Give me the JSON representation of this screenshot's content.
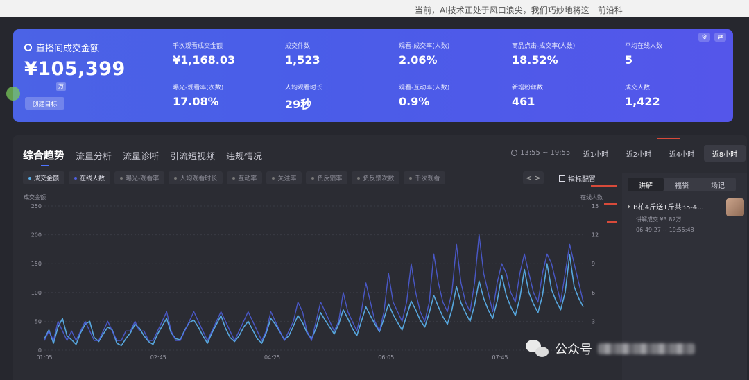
{
  "caption": "当前，AI技术正处于风口浪尖，我们巧妙地将这一前沿科",
  "hero": {
    "title": "直播间成交金额",
    "value": "¥105,399",
    "unit": "万",
    "goal_button": "创建目标"
  },
  "metrics": [
    {
      "label": "千次观看成交金额",
      "value": "¥1,168.03"
    },
    {
      "label": "成交件数",
      "value": "1,523"
    },
    {
      "label": "观看-成交率(人数)",
      "value": "2.06%"
    },
    {
      "label": "商品点击-成交率(人数)",
      "value": "18.52%"
    },
    {
      "label": "平均在线人数",
      "value": "5"
    },
    {
      "label": "曝光-观看率(次数)",
      "value": "17.08%"
    },
    {
      "label": "人均观看时长",
      "value": "29秒"
    },
    {
      "label": "观看-互动率(人数)",
      "value": "0.9%"
    },
    {
      "label": "新增粉丝数",
      "value": "461"
    },
    {
      "label": "成交人数",
      "value": "1,422"
    }
  ],
  "tabs": [
    "综合趋势",
    "流量分析",
    "流量诊断",
    "引流短视频",
    "违规情况"
  ],
  "time_range": "13:55 ~ 19:55",
  "periods": [
    "近1小时",
    "近2小时",
    "近4小时",
    "近8小时"
  ],
  "active_period": "近8小时",
  "chips": [
    "成交金额",
    "在线人数",
    "曝光-观看率",
    "人均观看时长",
    "互动率",
    "关注率",
    "负反馈率",
    "负反馈次数",
    "千次观看"
  ],
  "chip_nav": "< >",
  "config_label": "指标配置",
  "side_tabs": [
    "讲解",
    "福袋",
    "场记"
  ],
  "record": {
    "title": "B柏4斤送1斤共35-4...",
    "sub": "讲解成交 ¥3.82万",
    "time": "06:49:27 ~ 19:55:48"
  },
  "watermark": "公众号",
  "colors": {
    "card": "#4b63e6",
    "series_a": "#5aaee8",
    "series_b": "#4f5fe0",
    "accent": "#4f73ff"
  },
  "chart_data": {
    "type": "line",
    "left_axis_label": "成交金额",
    "right_axis_label": "在线人数",
    "left_ticks": [
      "250",
      "200",
      "150",
      "100",
      "50",
      "0"
    ],
    "right_ticks": [
      "15",
      "12",
      "9",
      "6",
      "3"
    ],
    "x_ticks": [
      "01:05",
      "02:45",
      "04:25",
      "06:05",
      "07:45"
    ],
    "ylim_left": [
      0,
      250
    ],
    "ylim_right": [
      0,
      15
    ],
    "series": [
      {
        "name": "成交金额",
        "axis": "left",
        "values": [
          20,
          35,
          12,
          40,
          55,
          25,
          18,
          10,
          30,
          45,
          50,
          22,
          15,
          28,
          40,
          35,
          12,
          8,
          20,
          30,
          45,
          38,
          25,
          15,
          10,
          28,
          42,
          55,
          30,
          20,
          18,
          35,
          48,
          52,
          40,
          25,
          12,
          30,
          45,
          60,
          38,
          22,
          15,
          25,
          40,
          50,
          35,
          20,
          12,
          30,
          55,
          45,
          32,
          18,
          25,
          42,
          60,
          48,
          30,
          20,
          38,
          65,
          52,
          40,
          28,
          45,
          70,
          55,
          38,
          25,
          50,
          75,
          60,
          45,
          32,
          55,
          80,
          62,
          48,
          35,
          60,
          85,
          70,
          52,
          40,
          65,
          95,
          75,
          58,
          45,
          70,
          110,
          82,
          65,
          50,
          78,
          120,
          90,
          70,
          55,
          85,
          130,
          95,
          75,
          60,
          90,
          140,
          100,
          80,
          65,
          95,
          150,
          105,
          85,
          70,
          100,
          165,
          110,
          90,
          75
        ]
      },
      {
        "name": "在线人数",
        "axis": "right",
        "values": [
          1,
          2,
          1,
          3,
          2,
          1,
          2,
          1,
          2,
          3,
          2,
          1,
          1,
          2,
          3,
          2,
          1,
          1,
          2,
          2,
          3,
          2,
          2,
          1,
          1,
          2,
          3,
          4,
          2,
          1,
          1,
          2,
          3,
          4,
          3,
          2,
          1,
          2,
          3,
          4,
          3,
          2,
          1,
          2,
          3,
          4,
          3,
          2,
          1,
          2,
          4,
          3,
          2,
          1,
          2,
          3,
          5,
          4,
          2,
          1,
          3,
          5,
          4,
          3,
          2,
          3,
          6,
          4,
          3,
          2,
          4,
          7,
          5,
          3,
          2,
          4,
          8,
          5,
          4,
          3,
          5,
          9,
          6,
          4,
          3,
          5,
          10,
          7,
          5,
          4,
          6,
          11,
          7,
          5,
          4,
          7,
          12,
          8,
          6,
          4,
          7,
          9,
          8,
          6,
          5,
          8,
          10,
          8,
          6,
          5,
          8,
          10,
          9,
          7,
          5,
          8,
          11,
          9,
          7,
          5
        ]
      }
    ]
  }
}
